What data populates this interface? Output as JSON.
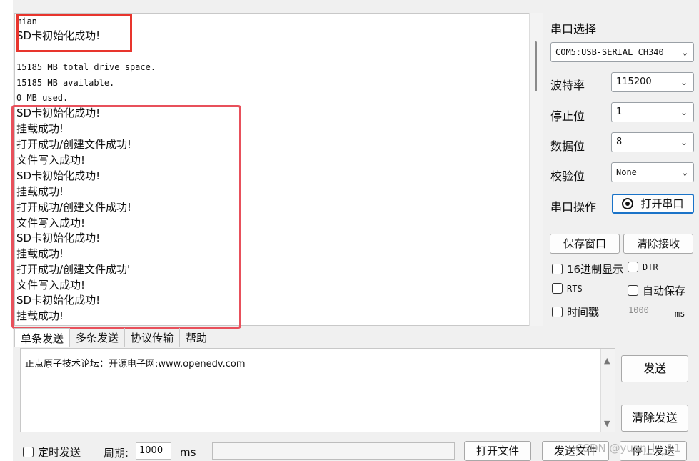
{
  "receive_lines": [
    "mian",
    "SD卡初始化成功!",
    "",
    "15185 MB total drive space.",
    "15185 MB available.",
    "0 MB  used.",
    "SD卡初始化成功!",
    "挂载成功!",
    "打开成功/创建文件成功!",
    "文件写入成功!",
    "SD卡初始化成功!",
    "挂载成功!",
    "打开成功/创建文件成功!",
    "文件写入成功!",
    "SD卡初始化成功!",
    "挂载成功!",
    "打开成功/创建文件成功'",
    "文件写入成功!",
    "SD卡初始化成功!",
    "挂载成功!"
  ],
  "serial": {
    "port_label": "串口选择",
    "port_value": "COM5:USB-SERIAL CH340",
    "baud_label": "波特率",
    "baud_value": "115200",
    "stop_label": "停止位",
    "stop_value": "1",
    "data_label": "数据位",
    "data_value": "8",
    "parity_label": "校验位",
    "parity_value": "None",
    "op_label": "串口操作",
    "open_port": "打开串口"
  },
  "buttons": {
    "save_window": "保存窗口",
    "clear_recv": "清除接收",
    "send": "发送",
    "clear_send": "清除发送",
    "open_file": "打开文件",
    "send_file": "发送文件",
    "stop_send": "停止发送"
  },
  "options": {
    "hex_display": "16进制显示",
    "dtr": "DTR",
    "rts": "RTS",
    "auto_save": "自动保存",
    "timestamp": "时间戳",
    "timestamp_ms": "1000",
    "ms_unit": "ms"
  },
  "tabs": [
    "单条发送",
    "多条发送",
    "协议传输",
    "帮助"
  ],
  "send_text": "正点原子技术论坛：开源电子网:www.openedv.com",
  "bottom": {
    "timed_send": "定时发送",
    "period_label": "周期:",
    "period_value": "1000",
    "ms_unit": "ms"
  },
  "watermark": "CSDN @yuan_lu_11"
}
